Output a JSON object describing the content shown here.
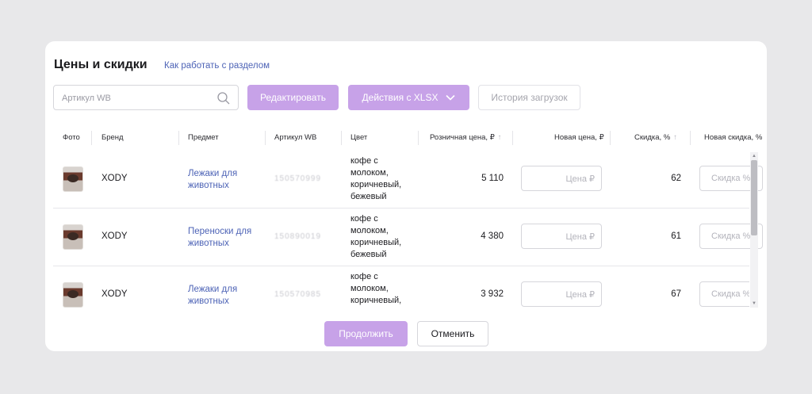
{
  "header": {
    "title": "Цены и скидки",
    "help_link": "Как работать с разделом"
  },
  "toolbar": {
    "search_placeholder": "Артикул WB",
    "edit_label": "Редактировать",
    "xlsx_label": "Действия с XLSX",
    "history_label": "История загрузок"
  },
  "table": {
    "columns": {
      "photo": "Фото",
      "brand": "Бренд",
      "subject": "Предмет",
      "article": "Артикул WB",
      "color": "Цвет",
      "retail_price": "Розничная цена, ₽",
      "new_price": "Новая цена, ₽",
      "discount": "Скидка, %",
      "new_discount": "Новая скидка, %"
    },
    "rows": [
      {
        "brand": "XODY",
        "subject_l1": "Лежаки для",
        "subject_l2": "животных",
        "article": "150570999",
        "color_l1": "кофе с",
        "color_l2": "молоком,",
        "color_l3": "коричневый,",
        "color_l4": "бежевый",
        "price": "5 110",
        "new_price_placeholder": "Цена ₽",
        "discount": "62",
        "new_discount_placeholder": "Скидка %"
      },
      {
        "brand": "XODY",
        "subject_l1": "Переноски для",
        "subject_l2": "животных",
        "article": "150890019",
        "color_l1": "кофе с",
        "color_l2": "молоком,",
        "color_l3": "коричневый,",
        "color_l4": "бежевый",
        "price": "4 380",
        "new_price_placeholder": "Цена ₽",
        "discount": "61",
        "new_discount_placeholder": "Скидка %"
      },
      {
        "brand": "XODY",
        "subject_l1": "Лежаки для",
        "subject_l2": "животных",
        "article": "150570985",
        "color_l1": "кофе с",
        "color_l2": "молоком,",
        "color_l3": "коричневый,",
        "color_l4": "",
        "price": "3 932",
        "new_price_placeholder": "Цена ₽",
        "discount": "67",
        "new_discount_placeholder": "Скидка %"
      }
    ]
  },
  "footer": {
    "continue_label": "Продолжить",
    "cancel_label": "Отменить"
  },
  "colors": {
    "accent": "#c7a2e8",
    "link": "#4d63b6",
    "background": "#e8e8ea"
  }
}
